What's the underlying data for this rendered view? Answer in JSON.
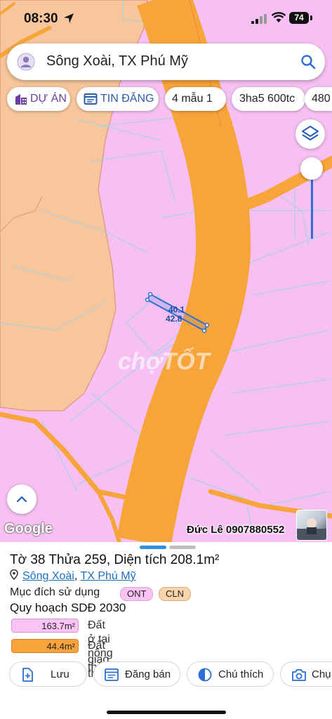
{
  "status": {
    "time": "08:30",
    "battery": "74"
  },
  "search": {
    "text": "Sông Xoài, TX Phú Mỹ"
  },
  "chips": [
    {
      "label": "DỰ ÁN",
      "icon": "building-icon"
    },
    {
      "label": "TIN ĐĂNG",
      "icon": "listing-icon"
    },
    {
      "label": "4 mẫu 1"
    },
    {
      "label": "3ha5 600tc"
    },
    {
      "label": "480"
    }
  ],
  "map": {
    "dims": {
      "a": "40.1",
      "b": "42.8"
    },
    "watermark": "chợTỐT",
    "google": "Google",
    "credit": "Đức Lê 0907880552",
    "colors": {
      "residential": "#f6c1f2",
      "agriculture": "#f7c69c",
      "road": "#f7a43a",
      "boundary": "#e59a8a",
      "parcel_lines": "#9ad5e8",
      "highlight": "#2f6fd6"
    }
  },
  "panel": {
    "title": "Tờ 38 Thửa 259, Diện tích 208.1m²",
    "address": {
      "ward": "Sông Xoài",
      "separator": ", ",
      "town": "TX Phú Mỹ"
    },
    "purpose_label": "Mục đích sử dụng",
    "badges": [
      {
        "code": "ONT",
        "color": "#f9c4f3"
      },
      {
        "code": "CLN",
        "color": "#f8d3ab"
      }
    ],
    "plan_title": "Quy hoạch SDĐ 2030",
    "legend": [
      {
        "area": "163.7m²",
        "label": "Đất ở tại nông thôn",
        "color": "#f9c4f3"
      },
      {
        "area": "44.4m²",
        "label": "Đất giao thông",
        "color": "#f7a43a"
      }
    ],
    "actions": [
      {
        "label": "Lưu",
        "icon": "add-file-icon"
      },
      {
        "label": "Đăng bán",
        "icon": "listing-icon"
      },
      {
        "label": "Chú thích",
        "icon": "half-circle-icon"
      },
      {
        "label": "Chụ",
        "icon": "camera-plus-icon"
      }
    ]
  }
}
